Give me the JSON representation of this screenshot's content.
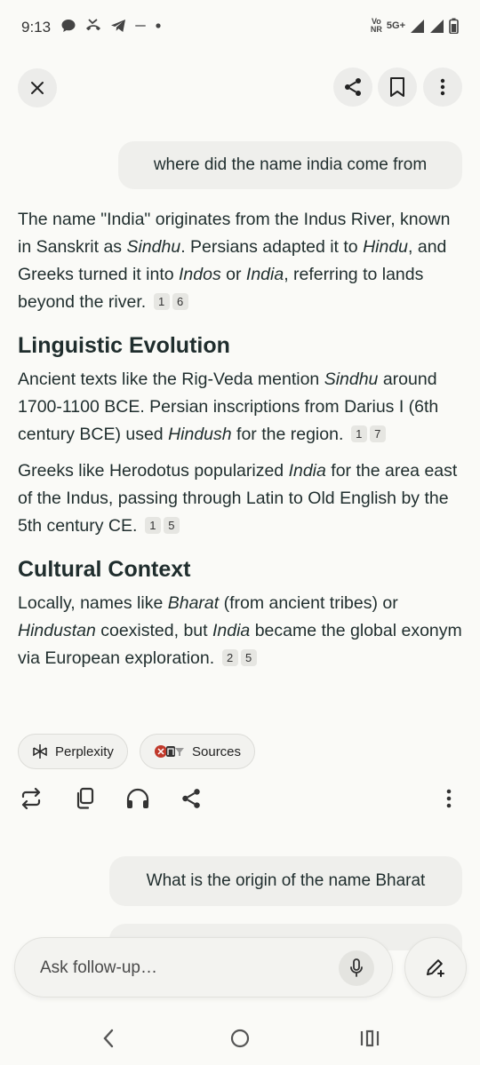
{
  "status_bar": {
    "time": "9:13",
    "volte": "Vo",
    "nr": "NR",
    "network": "5G+"
  },
  "header": {
    "close_icon": "close-icon",
    "share_icon": "share-icon",
    "bookmark_icon": "bookmark-icon",
    "more_icon": "more-vertical-icon"
  },
  "query_1": "where did the name india come from",
  "answer": {
    "intro": {
      "parts": [
        {
          "t": "The name \"India\" originates from the Indus River, known in Sanskrit as "
        },
        {
          "i": "Sindhu"
        },
        {
          "t": ". Persians adapted it to "
        },
        {
          "i": "Hindu"
        },
        {
          "t": ", and Greeks turned it into "
        },
        {
          "i": "Indos"
        },
        {
          "t": " or "
        },
        {
          "i": "India"
        },
        {
          "t": ", referring to lands beyond the river."
        }
      ],
      "citations": [
        "1",
        "6"
      ]
    },
    "section_1_title": "Linguistic Evolution",
    "section_1_p1": {
      "parts": [
        {
          "t": "Ancient texts like the Rig-Veda mention "
        },
        {
          "i": "Sindhu"
        },
        {
          "t": " around 1700-1100 BCE. Persian inscriptions from Darius I (6th century BCE) used "
        },
        {
          "i": "Hindush"
        },
        {
          "t": " for the region."
        }
      ],
      "citations": [
        "1",
        "7"
      ]
    },
    "section_1_p2": {
      "parts": [
        {
          "t": "Greeks like Herodotus popularized "
        },
        {
          "i": "India"
        },
        {
          "t": " for the area east of the Indus, passing through Latin to Old English by the 5th century CE."
        }
      ],
      "citations": [
        "1",
        "5"
      ]
    },
    "section_2_title": "Cultural Context",
    "section_2_p1": {
      "parts": [
        {
          "t": "Locally, names like "
        },
        {
          "i": "Bharat"
        },
        {
          "t": " (from ancient tribes) or "
        },
        {
          "i": "Hindustan"
        },
        {
          "t": " coexisted, but "
        },
        {
          "i": "India"
        },
        {
          "t": " became the global exonym via European exploration."
        }
      ],
      "citations": [
        "2",
        "5"
      ]
    }
  },
  "chips": {
    "perplexity_label": "Perplexity",
    "sources_label": "Sources"
  },
  "query_2": "What is the origin of the name Bharat",
  "followup": {
    "placeholder": "Ask follow-up…"
  },
  "colors": {
    "background": "#fafaf7",
    "bubble": "#efefec",
    "text": "#1f2d2d",
    "sources_red": "#c0392b"
  }
}
